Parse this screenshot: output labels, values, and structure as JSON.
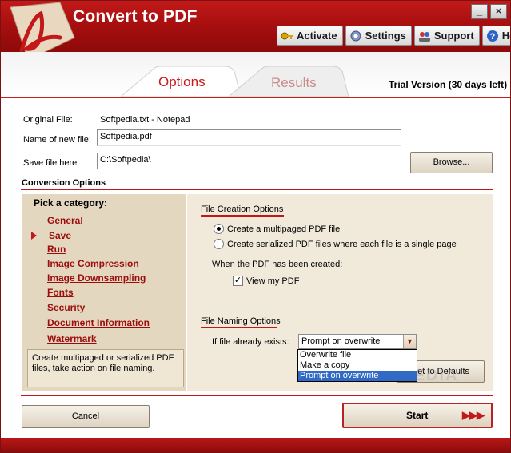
{
  "app": {
    "title": "Convert to PDF"
  },
  "window_controls": {
    "minimize": "_",
    "close": "×"
  },
  "toolbar": {
    "activate": "Activate",
    "settings": "Settings",
    "support": "Support",
    "help": "Help"
  },
  "tabs": {
    "options": "Options",
    "results": "Results"
  },
  "trial": "Trial Version (30 days left)",
  "file": {
    "original_label": "Original File:",
    "original_value": "Softpedia.txt - Notepad",
    "name_label": "Name of new  file:",
    "name_value": "Softpedia.pdf",
    "save_label": "Save file here:",
    "save_value": "C:\\Softpedia\\",
    "browse": "Browse..."
  },
  "conversion": {
    "title": "Conversion Options",
    "pick": "Pick a category:",
    "categories": [
      "General",
      "Save",
      "Run",
      "Image Compression",
      "Image Downsampling",
      "Fonts",
      "Security",
      "Document Information",
      "Watermark"
    ],
    "selected_category": "Save",
    "description": "Create multipaged or serialized PDF files, take action on file naming."
  },
  "creation": {
    "title": "File Creation Options",
    "opt1": "Create a multipaged PDF file",
    "opt2": "Create serialized PDF files where each file is a single page",
    "after_label": "When the PDF has been created:",
    "view_label": "View my PDF",
    "view_checked": true
  },
  "naming": {
    "title": "File Naming Options",
    "exists_label": "If file already exists:",
    "selected": "Prompt on overwrite",
    "options": [
      "Overwrite file",
      "Make a copy",
      "Prompt on overwrite"
    ],
    "reset": "Set to Defaults"
  },
  "buttons": {
    "cancel": "Cancel",
    "start": "Start",
    "start_arrows": "▶▶▶"
  },
  "colors": {
    "brand_red": "#c21818",
    "panel_tan": "#e4d7bf",
    "highlight_blue": "#316ac5"
  }
}
